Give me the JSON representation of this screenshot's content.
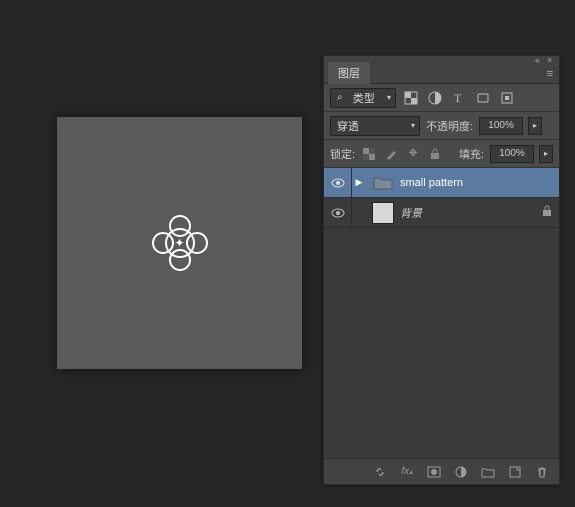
{
  "panel": {
    "tab_label": "图层",
    "type_filter": "类型",
    "blend_mode": "穿透",
    "opacity_label": "不透明度:",
    "opacity_value": "100%",
    "lock_label": "锁定:",
    "fill_label": "填充:",
    "fill_value": "100%"
  },
  "layers": [
    {
      "name": "small pattern",
      "kind": "folder",
      "selected": true,
      "locked": false
    },
    {
      "name": "背景",
      "kind": "image",
      "selected": false,
      "locked": true,
      "italic": true
    }
  ]
}
